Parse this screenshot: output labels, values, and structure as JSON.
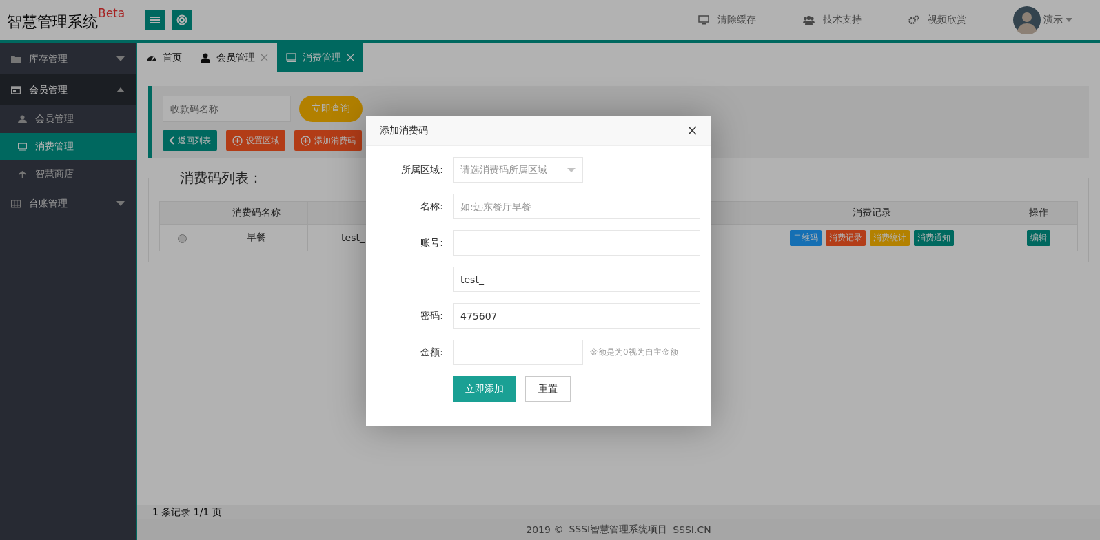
{
  "app": {
    "title": "智慧管理系统",
    "badge": "Beta"
  },
  "top_links": [
    {
      "label": "清除缓存",
      "kind": "monitor"
    },
    {
      "label": "技术支持",
      "kind": "users"
    },
    {
      "label": "视频欣赏",
      "kind": "gears"
    }
  ],
  "user": {
    "name": "演示"
  },
  "sidebar": {
    "items": [
      {
        "label": "库存管理",
        "kind": "folder",
        "expanded": false
      },
      {
        "label": "会员管理",
        "kind": "card",
        "expanded": true,
        "children": [
          {
            "label": "会员管理",
            "kind": "user",
            "selected": false
          },
          {
            "label": "消费管理",
            "kind": "screen",
            "selected": true
          },
          {
            "label": "智慧商店",
            "kind": "palm",
            "selected": false
          }
        ]
      },
      {
        "label": "台账管理",
        "kind": "grid",
        "expanded": false
      }
    ]
  },
  "tabs": [
    {
      "label": "首页",
      "kind": "gauge",
      "selected": false,
      "closable": false
    },
    {
      "label": "会员管理",
      "kind": "user",
      "selected": false,
      "closable": true
    },
    {
      "label": "消费管理",
      "kind": "screen",
      "selected": true,
      "closable": true
    }
  ],
  "search": {
    "placeholder": "收款码名称",
    "button": "立即查询"
  },
  "actions": [
    {
      "label": "返回列表",
      "kind": "back"
    },
    {
      "label": "设置区域",
      "kind": "add"
    },
    {
      "label": "添加消费码",
      "kind": "add"
    }
  ],
  "list_title": "消费码列表：",
  "table": {
    "columns": {
      "name": "消费码名称",
      "records": "消费记录",
      "actions": "操作"
    },
    "rows": [
      {
        "selected": false,
        "name": "早餐",
        "column_3": "test_",
        "tags": [
          {
            "label": "二维码",
            "color": "#156fb3"
          },
          {
            "label": "消费记录",
            "color": "#b33d18"
          },
          {
            "label": "消费统计",
            "color": "#b38100"
          },
          {
            "label": "消费通知",
            "color": "#00695f"
          }
        ],
        "action": "编辑"
      }
    ]
  },
  "pager": "1 条记录 1/1 页",
  "footer": {
    "year": "2019 ©",
    "project": "SSSI智慧管理系统项目",
    "site": "SSSI.CN"
  },
  "dialog": {
    "title": "添加消费码",
    "fields": [
      {
        "label": "所属区域:",
        "kind": "select",
        "placeholder": "请选消费码所属区域"
      },
      {
        "label": "名称:",
        "kind": "text",
        "placeholder": "如:远东餐厅早餐"
      },
      {
        "label": "账号:",
        "kind": "text"
      },
      {
        "kind": "text",
        "value": "test_"
      },
      {
        "label": "密码:",
        "kind": "text",
        "value": "475607"
      },
      {
        "label": "金额:",
        "kind": "short",
        "hint": "金额是为0视为自主金额"
      }
    ],
    "buttons": [
      {
        "label": "立即添加",
        "kind": "primary"
      },
      {
        "label": "重置",
        "kind": "plain"
      }
    ]
  }
}
